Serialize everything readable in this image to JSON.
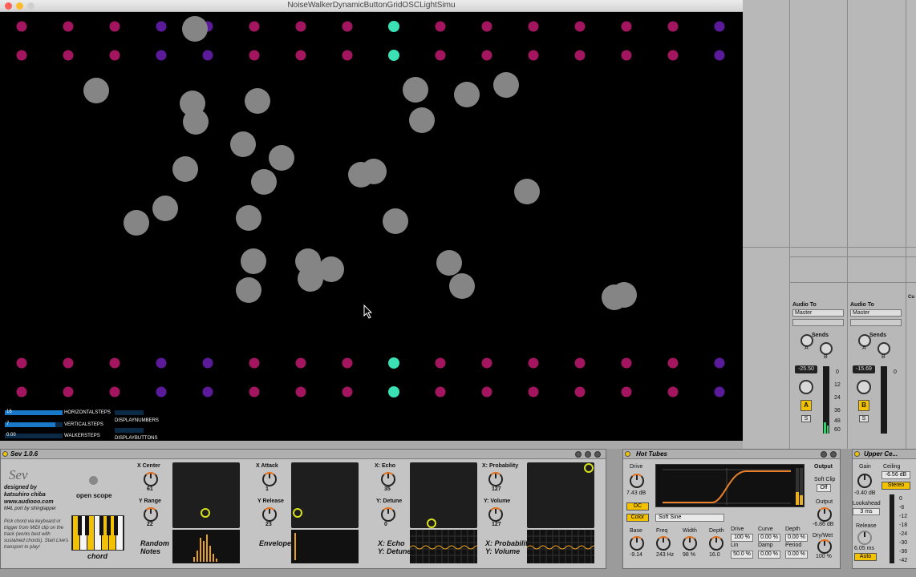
{
  "window": {
    "title": "NoiseWalkerDynamicButtonGridOSCLightSimu"
  },
  "sketch": {
    "colors": {
      "magenta": "#a3165f",
      "purple": "#5a1a9a",
      "teal": "#3be0b4",
      "walker": "#858585"
    },
    "grid_columns": 16,
    "top_rows": 2,
    "bottom_rows": 2,
    "controls": {
      "horizontal_steps": {
        "value": "16",
        "label": "HORIZONTALSTEPS",
        "fraction": 1.0
      },
      "vertical_steps": {
        "value": "7",
        "label": "VERTICALSTEPS",
        "fraction": 0.88
      },
      "walker_steps": {
        "value": "0.00",
        "label": "WALKERSTEPS",
        "fraction": 0.0
      },
      "display_numbers": {
        "label": "DISPLAYNUMBERS"
      },
      "display_buttons": {
        "label": "DISPLAYBUTTONS"
      }
    }
  },
  "mixer": {
    "strips": [
      {
        "audio_to_label": "Audio To",
        "audio_to_value": "Master",
        "sends_label": "Sends",
        "send_a": "A",
        "send_b": "B",
        "volume": "-25.50",
        "track_letter": "A",
        "solo": "S"
      },
      {
        "audio_to_label": "Audio To",
        "audio_to_value": "Master",
        "sends_label": "Sends",
        "send_a": "A",
        "send_b": "B",
        "volume": "-15.69",
        "track_letter": "B",
        "solo": "S"
      }
    ],
    "meter_scale": [
      "0",
      "12",
      "24",
      "36",
      "48",
      "60"
    ],
    "edge_label": "Cu"
  },
  "sev": {
    "title": "Sev 1.0.6",
    "logo": "Sev",
    "credits": [
      "designed by",
      "katsuhiro chiba",
      "www.audiooo.com",
      "M4L port by stringtapper"
    ],
    "help": "Pick chord via keyboard or trigger from MIDI clip on the track (works best with sustained chords). Start Live's transport to play!",
    "open_scope": "open scope",
    "chord": "chord",
    "sections": [
      {
        "k1_label": "X Center",
        "k1_value": "61",
        "k2_label": "Y Range",
        "k2_value": "22",
        "name_line1": "Random",
        "name_line2": "Notes",
        "pad_x": 0.49,
        "pad_y": 0.77
      },
      {
        "k1_label": "X Attack",
        "k1_value": "1",
        "k2_label": "Y Release",
        "k2_value": "23",
        "name_line1": "Envelope",
        "name_line2": "",
        "pad_x": 0.1,
        "pad_y": 0.77
      },
      {
        "k1_label": "X: Echo",
        "k1_value": "35",
        "k2_label": "Y: Detune",
        "k2_value": "0",
        "name_line1": "X: Echo",
        "name_line2": "Y: Detune",
        "pad_x": 0.32,
        "pad_y": 0.93
      },
      {
        "k1_label": "X: Probability",
        "k1_value": "127",
        "k2_label": "Y: Volume",
        "k2_value": "127",
        "name_line1": "X: Probability",
        "name_line2": "Y: Volume",
        "pad_x": 0.92,
        "pad_y": 0.08
      }
    ]
  },
  "hot_tubes": {
    "title": "Hot Tubes",
    "drive_label": "Drive",
    "drive_value": "7.43 dB",
    "dc": "DC",
    "color": "Color",
    "mode": "Soft Sine",
    "output_label": "Output",
    "soft_clip_label": "Soft Clip",
    "soft_clip_value": "Off",
    "output_knob_label": "Output",
    "output_value": "-6.86 dB",
    "dry_wet_label": "Dry/Wet",
    "dry_wet_value": "100 %",
    "bottom_knobs": [
      {
        "label": "Base",
        "value": "-9.14"
      },
      {
        "label": "Freq",
        "value": "243 Hz"
      },
      {
        "label": "Width",
        "value": "98 %"
      },
      {
        "label": "Depth",
        "value": "16.0"
      }
    ],
    "cols": [
      {
        "label": "Drive",
        "v1": "100 %",
        "sub": "Lin",
        "v2": "50.0 %"
      },
      {
        "label": "Curve",
        "v1": "0.00 %",
        "sub": "Damp",
        "v2": "0.00 %"
      },
      {
        "label": "Depth",
        "v1": "0.00 %",
        "sub": "Period",
        "v2": "0.00 %"
      }
    ]
  },
  "upper_ceiling": {
    "title": "Upper Ce...",
    "gain_label": "Gain",
    "gain_value": "-0.40 dB",
    "ceiling_label": "Ceiling",
    "ceiling_value": "-6.56 dB",
    "stereo": "Stereo",
    "lookahead_label": "Lookahead",
    "lookahead_value": "3 ms",
    "release_label": "Release",
    "release_value": "6.05 ms",
    "auto": "Auto",
    "scale": [
      "0",
      "-6",
      "-12",
      "-18",
      "-24",
      "-30",
      "-36",
      "-42"
    ]
  }
}
